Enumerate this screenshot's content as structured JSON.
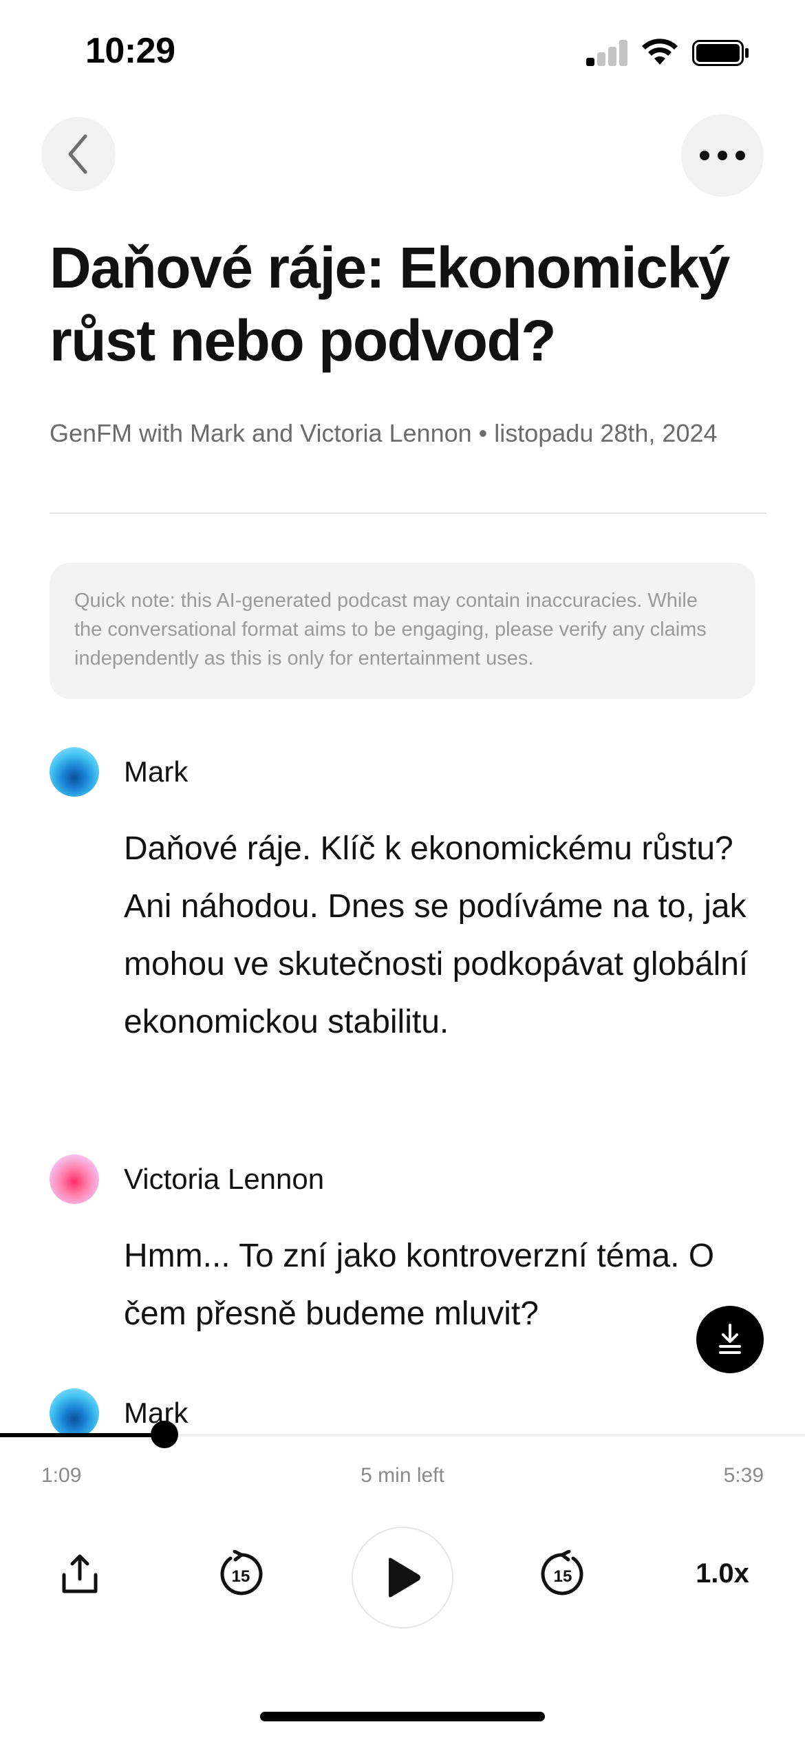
{
  "status_bar": {
    "time": "10:29"
  },
  "title": "Daňové ráje: Ekonomický růst nebo podvod?",
  "meta": "GenFM with Mark and Victoria Lennon • listopadu 28th, 2024",
  "note": "Quick note: this AI-generated podcast may contain inaccuracies. While the conversational format aims to be engaging, please verify any claims independently as this is only for entertainment uses.",
  "transcript": [
    {
      "speaker": "Mark",
      "avatar": "blue-gradient-avatar",
      "text": "Daňové ráje. Klíč k ekonomickému růstu? Ani náhodou. Dnes se podíváme na to, jak mohou ve skutečnosti podkopávat globální ekonomickou stabilitu."
    },
    {
      "speaker": "Victoria Lennon",
      "avatar": "pink-gradient-avatar",
      "text": "Hmm... To zní jako kontroverzní téma. O čem přesně budeme mluvit?"
    },
    {
      "speaker": "Mark",
      "avatar": "blue-gradient-avatar",
      "text": ""
    }
  ],
  "player": {
    "elapsed": "1:09",
    "remaining": "5 min left",
    "duration": "5:39",
    "progress_fraction": 0.204,
    "rewind_seconds": "15",
    "forward_seconds": "15",
    "speed": "1.0x"
  },
  "icons": {
    "back": "chevron-left-icon",
    "more": "ellipsis-icon",
    "download": "download-icon",
    "share": "share-icon",
    "rewind": "rewind-15-icon",
    "play": "play-icon",
    "forward": "forward-15-icon"
  },
  "colors": {
    "accent": "#000000",
    "muted_text": "#6b6b6b",
    "note_bg": "#f3f3f3"
  }
}
